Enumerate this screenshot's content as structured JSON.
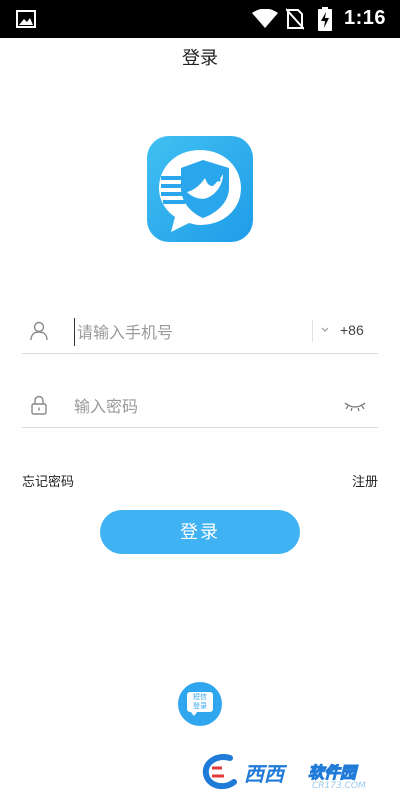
{
  "status_bar": {
    "time": "1:16",
    "icons": [
      "image-icon",
      "wifi-icon",
      "no-sim-icon",
      "battery-charging-icon"
    ]
  },
  "header": {
    "title": "登录"
  },
  "logo": {
    "icon": "chat-shield-bird-logo",
    "colors": [
      "#41c0f2",
      "#1e9ce8"
    ]
  },
  "form": {
    "phone": {
      "icon": "user-icon",
      "placeholder": "请输入手机号",
      "value": "",
      "country_code": "+86"
    },
    "password": {
      "icon": "lock-icon",
      "placeholder": "输入密码",
      "value": "",
      "toggle_icon": "eye-closed-icon"
    }
  },
  "links": {
    "forgot_password": "忘记密码",
    "register": "注册"
  },
  "login_button": {
    "label": "登录",
    "color": "#3fb2f3"
  },
  "sms_login": {
    "line1": "短信",
    "line2": "登录"
  },
  "watermark": {
    "brand": "西西",
    "name": "软件园",
    "url": "CR173.COM"
  }
}
